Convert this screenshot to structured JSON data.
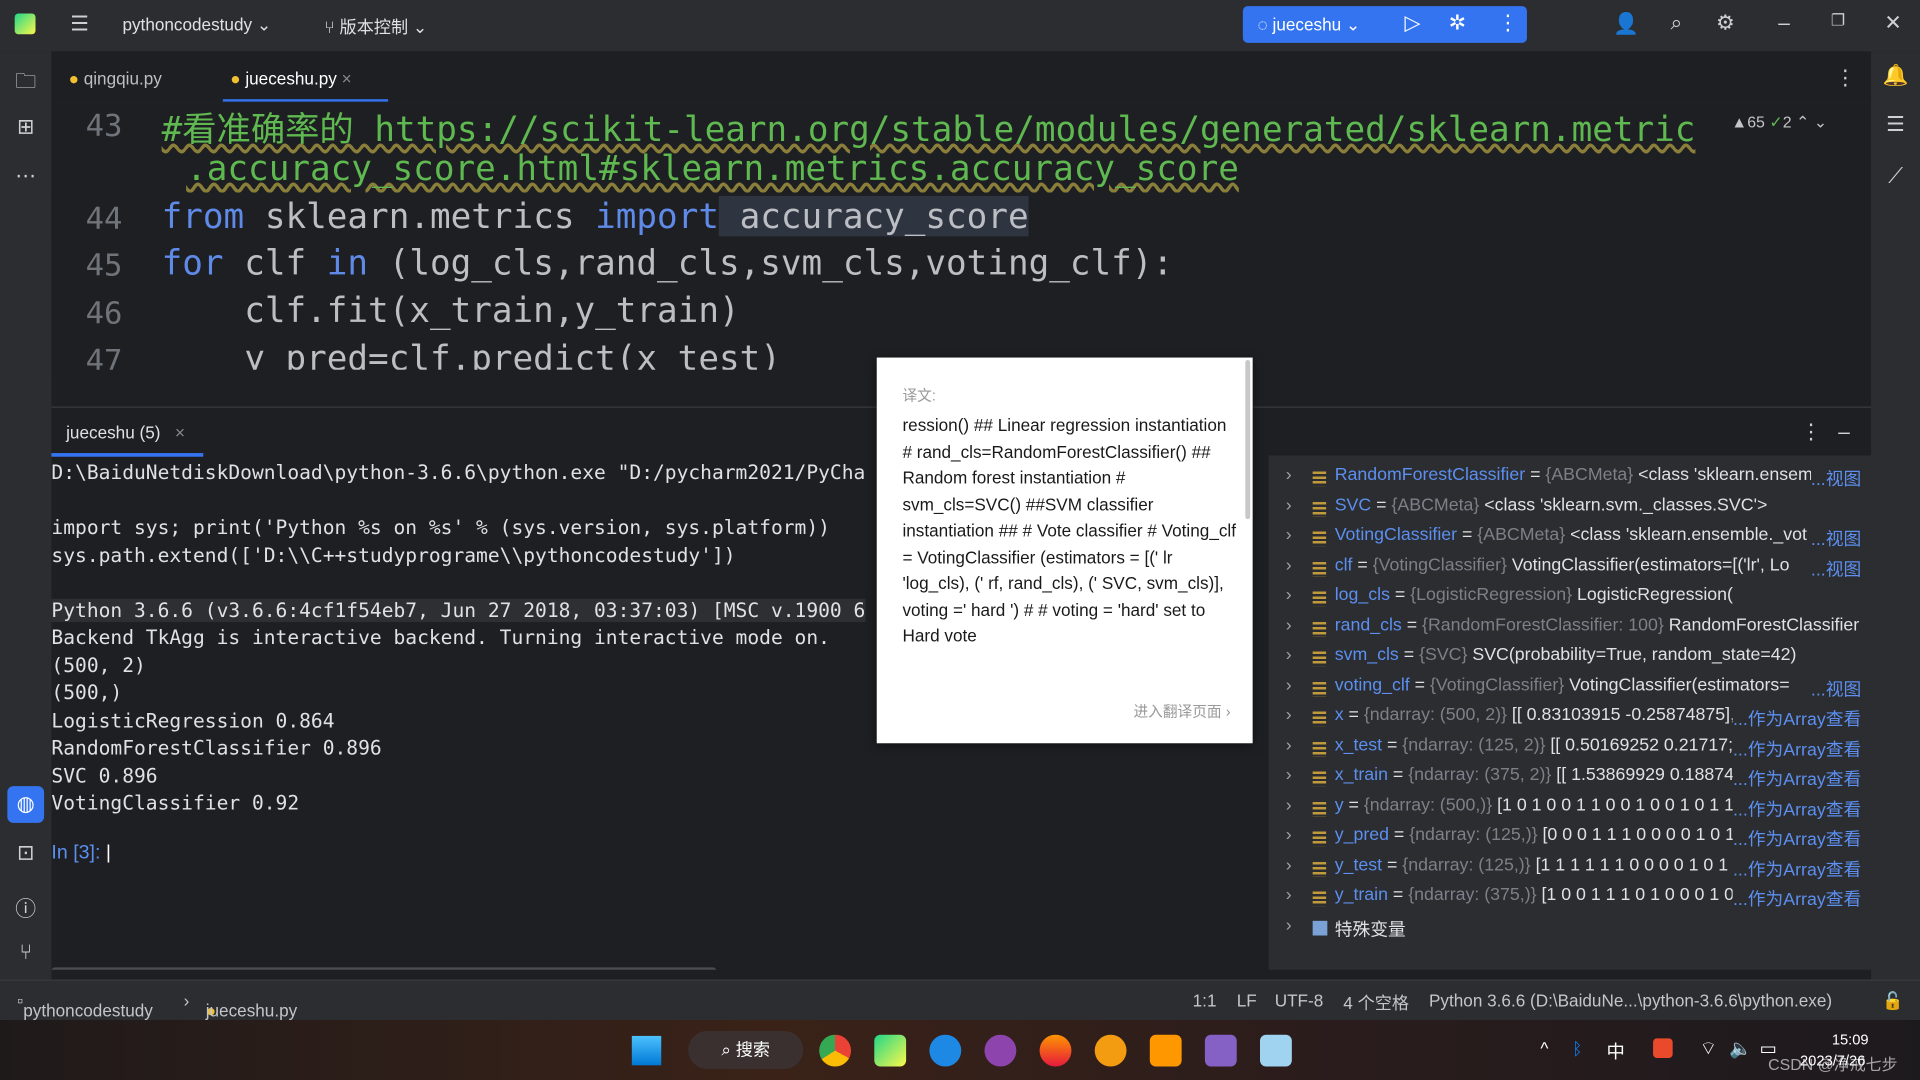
{
  "titlebar": {
    "project": "pythoncodestudy",
    "vcs": "版本控制",
    "run_config": "jueceshu"
  },
  "tabs": [
    {
      "label": "qingqiu.py"
    },
    {
      "label": "jueceshu.py"
    }
  ],
  "editor": {
    "inspections": {
      "warnings": "65",
      "weak": "2"
    },
    "lines": [
      {
        "no": "43",
        "comment": "#看准确率的 https://scikit-learn.org/stable/modules/generated/sklearn.metric",
        "cont": ".accuracy_score.html#sklearn.metrics.accuracy_score"
      },
      {
        "no": "44",
        "kw1": "from",
        "mid": " sklearn.metrics ",
        "kw2": "import",
        "rest": " accuracy_score"
      },
      {
        "no": "45",
        "kw1": "for",
        "mid": " clf ",
        "kw2": "in",
        "rest": " (log_cls,rand_cls,svm_cls,voting_clf):"
      },
      {
        "no": "46",
        "rest": "    clf.fit(x_train,y_train)"
      },
      {
        "no": "47",
        "rest": "    y_pred=clf.predict(x_test)"
      }
    ]
  },
  "console": {
    "tab": "jueceshu (5)",
    "lines": [
      "D:\\BaiduNetdiskDownload\\python-3.6.6\\python.exe \"D:/pycharm2021/PyCha",
      "",
      "import sys; print('Python %s on %s' % (sys.version, sys.platform))",
      "sys.path.extend(['D:\\\\C++studyprograme\\\\pythoncodestudy'])",
      "",
      "Python 3.6.6 (v3.6.6:4cf1f54eb7, Jun 27 2018, 03:37:03) [MSC v.1900 6",
      "Backend TkAgg is interactive backend. Turning interactive mode on.",
      "(500, 2)",
      "(500,)",
      "LogisticRegression 0.864",
      "RandomForestClassifier 0.896",
      "SVC 0.896",
      "VotingClassifier 0.92"
    ],
    "prompt": "In [3]:"
  },
  "variables": [
    {
      "name": "RandomForestClassifier",
      "type": "{ABCMeta}",
      "value": "<class 'sklearn.ensem",
      "link": "...视图"
    },
    {
      "name": "SVC",
      "type": "{ABCMeta}",
      "value": "<class 'sklearn.svm._classes.SVC'>",
      "link": ""
    },
    {
      "name": "VotingClassifier",
      "type": "{ABCMeta}",
      "value": "<class 'sklearn.ensemble._vot",
      "link": "...视图"
    },
    {
      "name": "clf",
      "type": "{VotingClassifier}",
      "value": "VotingClassifier(estimators=[('lr', Lo",
      "link": "...视图"
    },
    {
      "name": "log_cls",
      "type": "{LogisticRegression}",
      "value": "LogisticRegression(",
      "link": ""
    },
    {
      "name": "rand_cls",
      "type": "{RandomForestClassifier: 100}",
      "value": "RandomForestClassifier",
      "link": ""
    },
    {
      "name": "svm_cls",
      "type": "{SVC}",
      "value": "SVC(probability=True, random_state=42)",
      "link": ""
    },
    {
      "name": "voting_clf",
      "type": "{VotingClassifier}",
      "value": "VotingClassifier(estimators=",
      "link": "...视图"
    },
    {
      "name": "x",
      "type": "{ndarray: (500, 2)}",
      "value": "[[ 0.83103915 -0.25874875],",
      "link": "...作为Array查看"
    },
    {
      "name": "x_test",
      "type": "{ndarray: (125, 2)}",
      "value": "[[ 0.50169252  0.21717;",
      "link": "...作为Array查看"
    },
    {
      "name": "x_train",
      "type": "{ndarray: (375, 2)}",
      "value": "[[ 1.53869929  0.18874",
      "link": "...作为Array查看"
    },
    {
      "name": "y",
      "type": "{ndarray: (500,)}",
      "value": "[1 0 1 0 0 1 1 0 0 1 0 0 1 0 1 1 ",
      "link": "...作为Array查看"
    },
    {
      "name": "y_pred",
      "type": "{ndarray: (125,)}",
      "value": "[0 0 0 1 1 1 0 0 0 0 1 0 1 ",
      "link": "...作为Array查看"
    },
    {
      "name": "y_test",
      "type": "{ndarray: (125,)}",
      "value": "[1 1 1 1 1 1 0 0 0 0 1 0 1 ",
      "link": "...作为Array查看"
    },
    {
      "name": "y_train",
      "type": "{ndarray: (375,)}",
      "value": "[1 0 0 1 1 1 0 1 0 0 0 1 0 ",
      "link": "...作为Array查看"
    }
  ],
  "special_vars": "特殊变量",
  "popup": {
    "label": "译文:",
    "text": "ression() ## Linear regression instantiation\n# rand_cls=RandomForestClassifier() ## Random forest instantiation\n# svm_cls=SVC() ##SVM classifier instantiation\n## # Vote classifier\n# Voting_clf = VotingClassifier (estimators = [(' lr 'log_cls), (' rf, rand_cls), (' SVC, svm_cls)], voting =' hard ') # # voting = 'hard' set to Hard vote",
    "more": "进入翻译页面 ›"
  },
  "status": {
    "project": "pythoncodestudy",
    "file": "jueceshu.py",
    "pos": "1:1",
    "eol": "LF",
    "enc": "UTF-8",
    "indent": "4 个空格",
    "interp": "Python 3.6.6 (D:\\BaiduNe...\\python-3.6.6\\python.exe)"
  },
  "taskbar": {
    "search": "搜索",
    "ime": "中",
    "time": "15:09",
    "date": "2023/7/26",
    "watermark": "CSDN @净戒七步"
  },
  "colors": {
    "accent": "#3574f0",
    "keyword": "#5f8ae8",
    "comment": "#5fb950",
    "var_name": "#5c8ff0"
  }
}
